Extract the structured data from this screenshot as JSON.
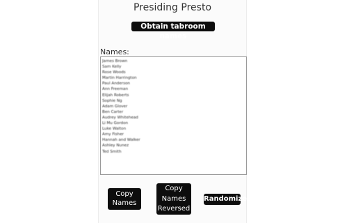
{
  "app": {
    "title": "Presiding Presto"
  },
  "buttons": {
    "obtain_label": "Obtain tabroom names",
    "copy_names_line1": "Copy",
    "copy_names_line2": "Names",
    "copy_reversed_line1": "Copy",
    "copy_reversed_line2": "Names",
    "copy_reversed_line3": "Reversed",
    "randomize_label": "Randomize"
  },
  "names_label": "Names:",
  "names": [
    "James Brown",
    "Sam Kelly",
    "Rose Woods",
    "Martin Harrington",
    "Paul Anderson",
    "Ann Freeman",
    "Elijah Roberts",
    "Sophie Ng",
    "Adam Glover",
    "Ben Carter",
    "Audrey Whitehead",
    "Li Mu Gordon",
    "Luke Walton",
    "Amy Fisher",
    "Hannah and Walker",
    "Ashley Nunez",
    "Ted Smith"
  ]
}
